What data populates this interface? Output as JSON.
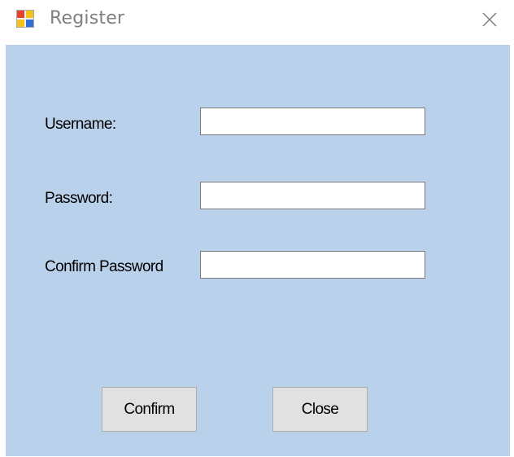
{
  "window": {
    "title": "Register",
    "app_icon": "windows-form-icon",
    "close_icon": "close-icon"
  },
  "form": {
    "username": {
      "label": "Username:",
      "value": ""
    },
    "password": {
      "label": "Password:",
      "value": ""
    },
    "confirm_password": {
      "label": "Confirm Password",
      "value": ""
    }
  },
  "buttons": {
    "confirm_label": "Confirm",
    "close_label": "Close"
  },
  "colors": {
    "client_background": "#b9d1ea",
    "button_face": "#e1e1e1",
    "title_text": "#808080"
  }
}
